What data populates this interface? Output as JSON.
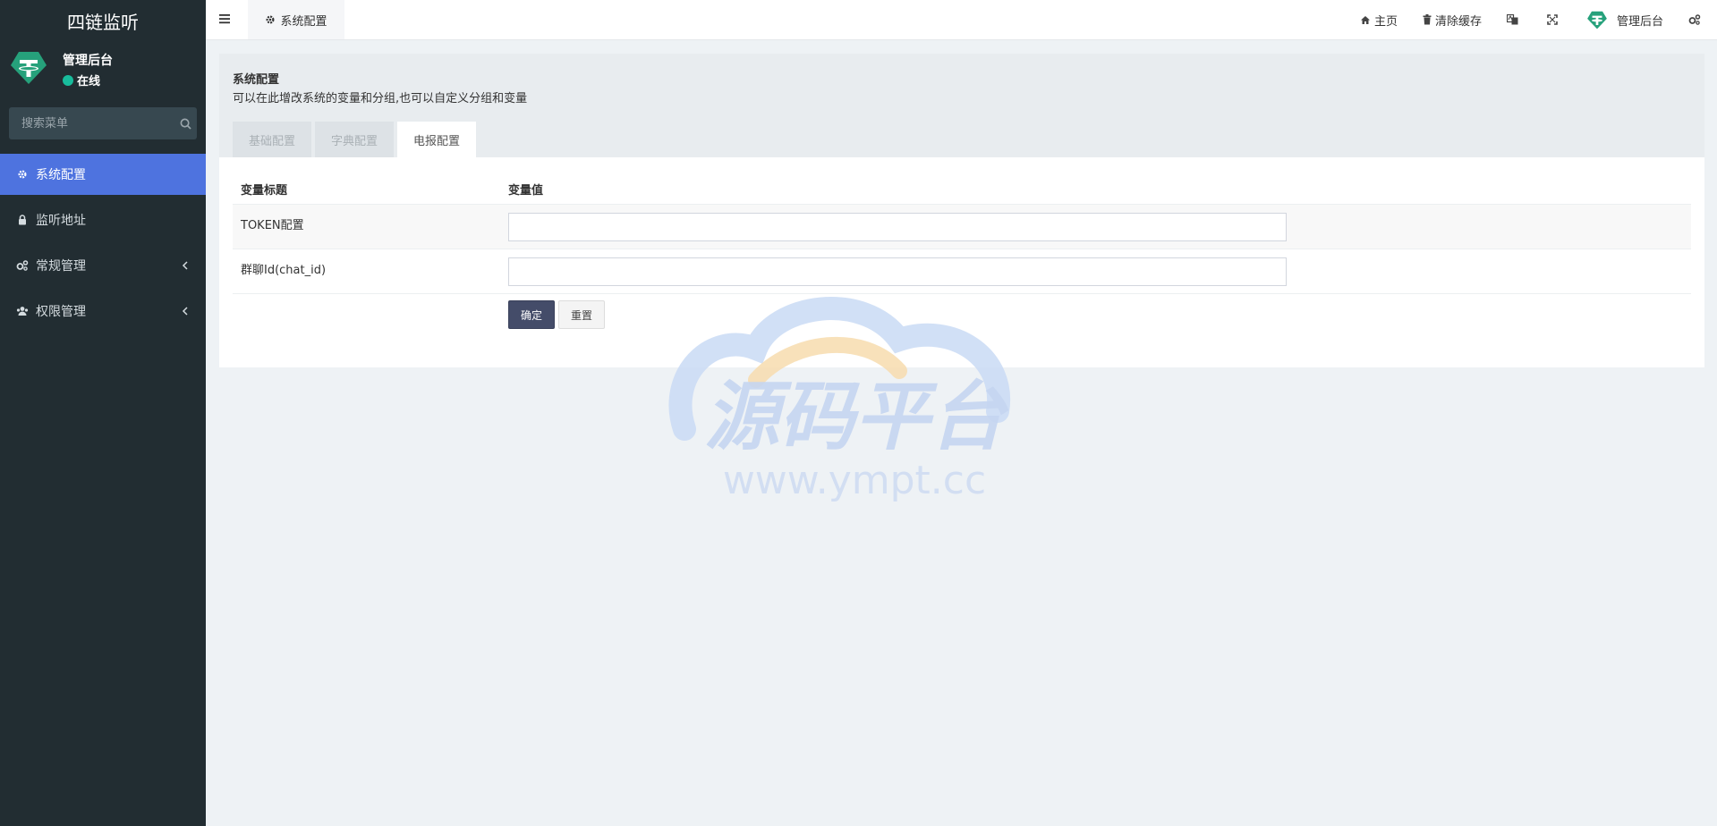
{
  "app": {
    "title": "四链监听"
  },
  "user": {
    "name": "管理后台",
    "status": "在线"
  },
  "search": {
    "placeholder": "搜索菜单"
  },
  "menu": [
    {
      "label": "系统配置",
      "icon": "gear-icon",
      "active": true
    },
    {
      "label": "监听地址",
      "icon": "lock-icon"
    },
    {
      "label": "常规管理",
      "icon": "cogs-icon",
      "has_children": true
    },
    {
      "label": "权限管理",
      "icon": "users-icon",
      "has_children": true
    }
  ],
  "header": {
    "active_tab": "系统配置",
    "home": "主页",
    "clear_cache": "清除缓存",
    "user": "管理后台"
  },
  "panel": {
    "title": "系统配置",
    "description": "可以在此增改系统的变量和分组,也可以自定义分组和变量",
    "tabs": [
      "基础配置",
      "字典配置",
      "电报配置"
    ],
    "active_tab": "电报配置"
  },
  "table": {
    "columns": [
      "变量标题",
      "变量值"
    ],
    "rows": [
      {
        "label": "TOKEN配置",
        "value": ""
      },
      {
        "label": "群聊Id(chat_id)",
        "value": ""
      }
    ]
  },
  "buttons": {
    "ok": "确定",
    "reset": "重置"
  },
  "watermark": {
    "title": "源码平台",
    "url": "www.ympt.cc"
  },
  "colors": {
    "sidebar": "#222d32",
    "accent": "#4e73df",
    "primary_btn": "#444c69",
    "online": "#18bc9c"
  }
}
